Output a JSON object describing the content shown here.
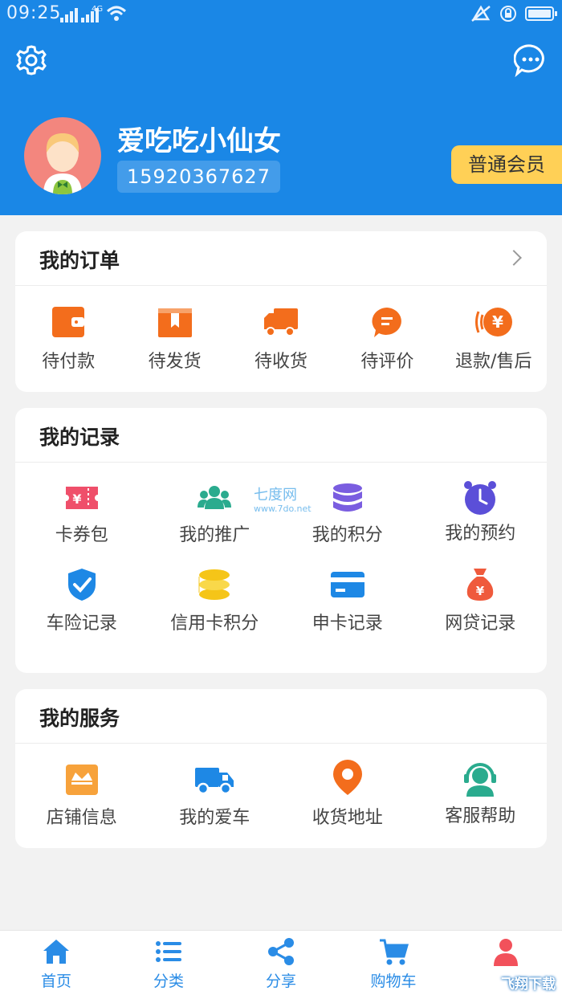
{
  "status": {
    "time": "09:25",
    "network": "4G"
  },
  "header": {
    "username": "爱吃吃小仙女",
    "phone": "15920367627",
    "member_level": "普通会员",
    "settings_icon": "gear-icon",
    "message_icon": "chat-bubble-icon"
  },
  "orders": {
    "title": "我的订单",
    "items": [
      {
        "label": "待付款",
        "icon": "wallet-icon",
        "color": "#f36d1c"
      },
      {
        "label": "待发货",
        "icon": "box-icon",
        "color": "#f36d1c"
      },
      {
        "label": "待收货",
        "icon": "truck-icon",
        "color": "#f36d1c"
      },
      {
        "label": "待评价",
        "icon": "comment-icon",
        "color": "#f36d1c"
      },
      {
        "label": "退款/售后",
        "icon": "refund-icon",
        "color": "#f36d1c"
      }
    ]
  },
  "records": {
    "title": "我的记录",
    "items": [
      {
        "label": "卡券包",
        "icon": "coupon-icon",
        "color": "#ef4f6a"
      },
      {
        "label": "我的推广",
        "icon": "group-icon",
        "color": "#2aab8e"
      },
      {
        "label": "我的积分",
        "icon": "database-icon",
        "color": "#7a5de0"
      },
      {
        "label": "我的预约",
        "icon": "alarm-clock-icon",
        "color": "#5b4fd8"
      },
      {
        "label": "车险记录",
        "icon": "shield-check-icon",
        "color": "#1e88e5"
      },
      {
        "label": "信用卡积分",
        "icon": "coins-icon",
        "color": "#f5c518"
      },
      {
        "label": "申卡记录",
        "icon": "credit-card-icon",
        "color": "#1e88e5"
      },
      {
        "label": "网贷记录",
        "icon": "money-bag-icon",
        "color": "#ef5a3c"
      }
    ]
  },
  "services": {
    "title": "我的服务",
    "items": [
      {
        "label": "店铺信息",
        "icon": "shop-icon",
        "color": "#f7a23b"
      },
      {
        "label": "我的爱车",
        "icon": "delivery-truck-icon",
        "color": "#1e88e5"
      },
      {
        "label": "收货地址",
        "icon": "location-pin-icon",
        "color": "#f36d1c"
      },
      {
        "label": "客服帮助",
        "icon": "customer-service-icon",
        "color": "#2aab8e"
      }
    ]
  },
  "watermark": {
    "name": "七度网",
    "url": "www.7do.net"
  },
  "tabbar": {
    "items": [
      {
        "label": "首页",
        "icon": "home-icon"
      },
      {
        "label": "分类",
        "icon": "list-icon"
      },
      {
        "label": "分享",
        "icon": "share-icon"
      },
      {
        "label": "购物车",
        "icon": "cart-icon"
      },
      {
        "label": "",
        "icon": "profile-icon"
      }
    ]
  },
  "corner_watermark": "飞翔下载"
}
